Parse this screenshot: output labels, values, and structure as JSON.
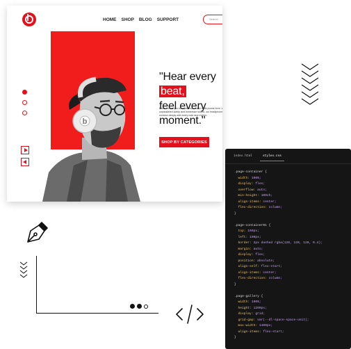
{
  "nav": {
    "items": [
      "HOME",
      "SHOP",
      "BLOG",
      "SUPPORT"
    ]
  },
  "search": {
    "placeholder": "Search"
  },
  "hero": {
    "headline_line1_prefix": "\"Hear every ",
    "headline_highlight": "beat,",
    "headline_line2": "feel every moment.\"",
    "body": "Beats invites you to experience music in its purest form. With unparalleled clarity and immersive sound, our headphones let you connect deeply with every note and rhythm.",
    "cta_label": "SHOP BY CATEGORIES"
  },
  "slider": {
    "dot_count": 3,
    "active_index": 0
  },
  "editor": {
    "tabs": [
      "index.html",
      "styles.css"
    ],
    "active_tab": 1,
    "lines": [
      ".page-container {",
      "  width: 100%;",
      "  display: flex;",
      "  overflow: auto;",
      "  min-height: 100vh;",
      "  align-items: center;",
      "  flex-direction: column;",
      "}",
      "",
      ".page-container01 {",
      "  top: 100px;",
      "  left: 100px;",
      "  border: 2px dashed rgba(120, 120, 120, 0.4);",
      "  margin: auto;",
      "  display: flex;",
      "  position: absolute;",
      "  align-self: flex-start;",
      "  align-items: center;",
      "  flex-direction: column;",
      "}",
      "",
      ".page-gallery {",
      "  width: 100%;",
      "  height: 1200px;",
      "  display: grid;",
      "  grid-gap: var(--dl-space-space-unit);",
      "  max-width: 1400px;",
      "  align-items: flex-start;",
      "}"
    ]
  },
  "colors": {
    "brand_red": "#e4111c",
    "editor_bg": "#151515",
    "prop": "#e8c36a",
    "value": "#c7a3f0"
  },
  "decor": {
    "code_icon": "</>"
  }
}
